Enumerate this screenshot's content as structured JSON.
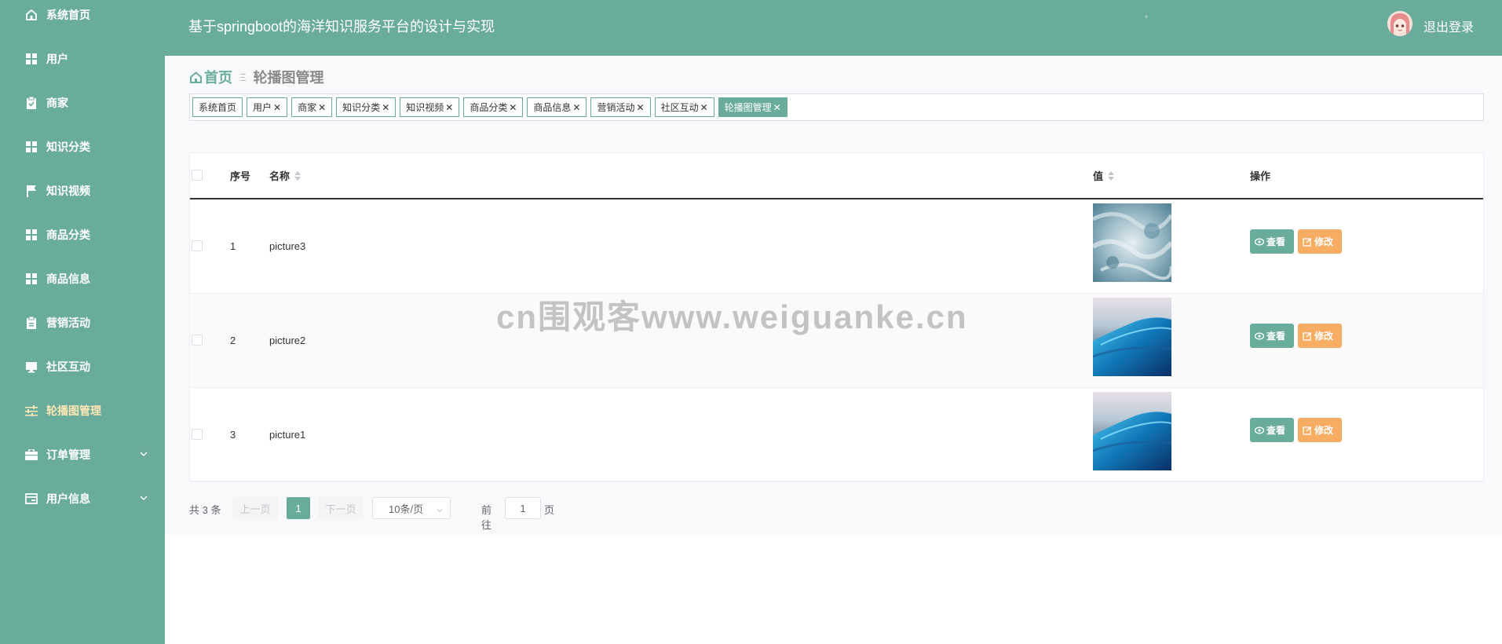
{
  "sidebar": {
    "items": [
      {
        "label": "系统首页",
        "icon": "home-icon"
      },
      {
        "label": "用户",
        "icon": "grid-icon"
      },
      {
        "label": "商家",
        "icon": "clipboard-icon"
      },
      {
        "label": "知识分类",
        "icon": "grid-icon"
      },
      {
        "label": "知识视频",
        "icon": "flag-icon"
      },
      {
        "label": "商品分类",
        "icon": "grid-icon"
      },
      {
        "label": "商品信息",
        "icon": "grid-icon"
      },
      {
        "label": "营销活动",
        "icon": "clipboard-icon"
      },
      {
        "label": "社区互动",
        "icon": "monitor-icon"
      },
      {
        "label": "轮播图管理",
        "icon": "sliders-icon",
        "active": true
      },
      {
        "label": "订单管理",
        "icon": "briefcase-icon",
        "expandable": true
      },
      {
        "label": "用户信息",
        "icon": "card-icon",
        "expandable": true
      }
    ]
  },
  "header": {
    "title": "基于springboot的海洋知识服务平台的设计与实现",
    "dot": "◦",
    "logout_label": "退出登录"
  },
  "breadcrumb": {
    "home": "首页",
    "separator": "Ξ",
    "current": "轮播图管理"
  },
  "tags": [
    {
      "label": "系统首页",
      "closable": false
    },
    {
      "label": "用户",
      "closable": true
    },
    {
      "label": "商家",
      "closable": true
    },
    {
      "label": "知识分类",
      "closable": true
    },
    {
      "label": "知识视频",
      "closable": true
    },
    {
      "label": "商品分类",
      "closable": true
    },
    {
      "label": "商品信息",
      "closable": true
    },
    {
      "label": "营销活动",
      "closable": true
    },
    {
      "label": "社区互动",
      "closable": true
    },
    {
      "label": "轮播图管理",
      "closable": true,
      "active": true
    }
  ],
  "table": {
    "columns": {
      "index": "序号",
      "name": "名称",
      "value": "值",
      "actions": "操作"
    },
    "rows": [
      {
        "index": "1",
        "name": "picture3",
        "image": "foam"
      },
      {
        "index": "2",
        "name": "picture2",
        "image": "wave"
      },
      {
        "index": "3",
        "name": "picture1",
        "image": "wave"
      }
    ],
    "view_label": "查看",
    "edit_label": "修改"
  },
  "pagination": {
    "total": "共 3 条",
    "prev": "上一页",
    "page": "1",
    "next": "下一页",
    "page_size": "10条/页",
    "goto": "前往",
    "goto_value": "1",
    "page_unit": "页"
  },
  "watermark": "cn围观客www.weiguanke.cn",
  "colors": {
    "primary": "#6aac9c",
    "edit": "#f6ad63",
    "active_menu": "#fde7b4"
  }
}
